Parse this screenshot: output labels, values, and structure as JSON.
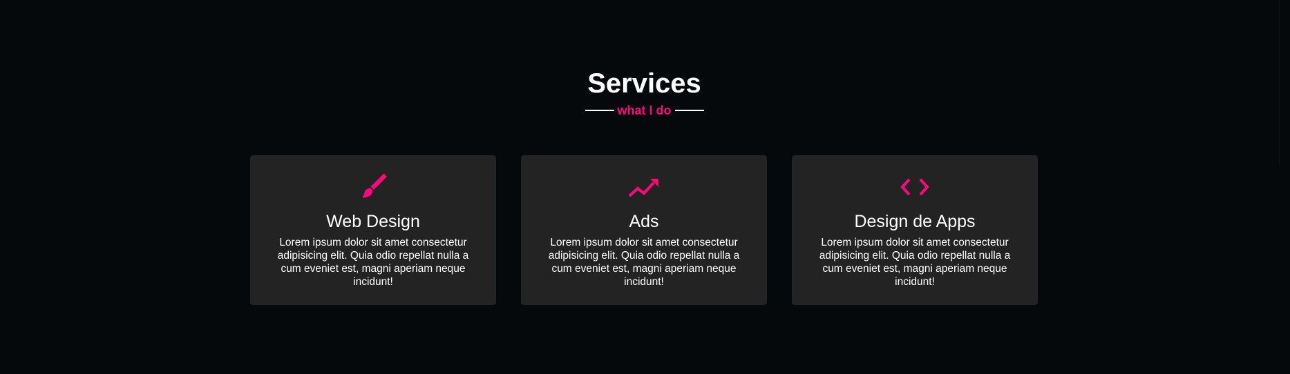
{
  "section": {
    "title": "Services",
    "subtitle": "what I do",
    "accent_color": "#ff0a7a"
  },
  "cards": [
    {
      "icon": "paintbrush-icon",
      "title": "Web Design",
      "text": "Lorem ipsum dolor sit amet consectetur adipisicing elit. Quia odio repellat nulla a cum eveniet est, magni aperiam neque incidunt!"
    },
    {
      "icon": "trending-up-icon",
      "title": "Ads",
      "text": "Lorem ipsum dolor sit amet consectetur adipisicing elit. Quia odio repellat nulla a cum eveniet est, magni aperiam neque incidunt!"
    },
    {
      "icon": "code-icon",
      "title": "Design de Apps",
      "text": "Lorem ipsum dolor sit amet consectetur adipisicing elit. Quia odio repellat nulla a cum eveniet est, magni aperiam neque incidunt!"
    }
  ]
}
